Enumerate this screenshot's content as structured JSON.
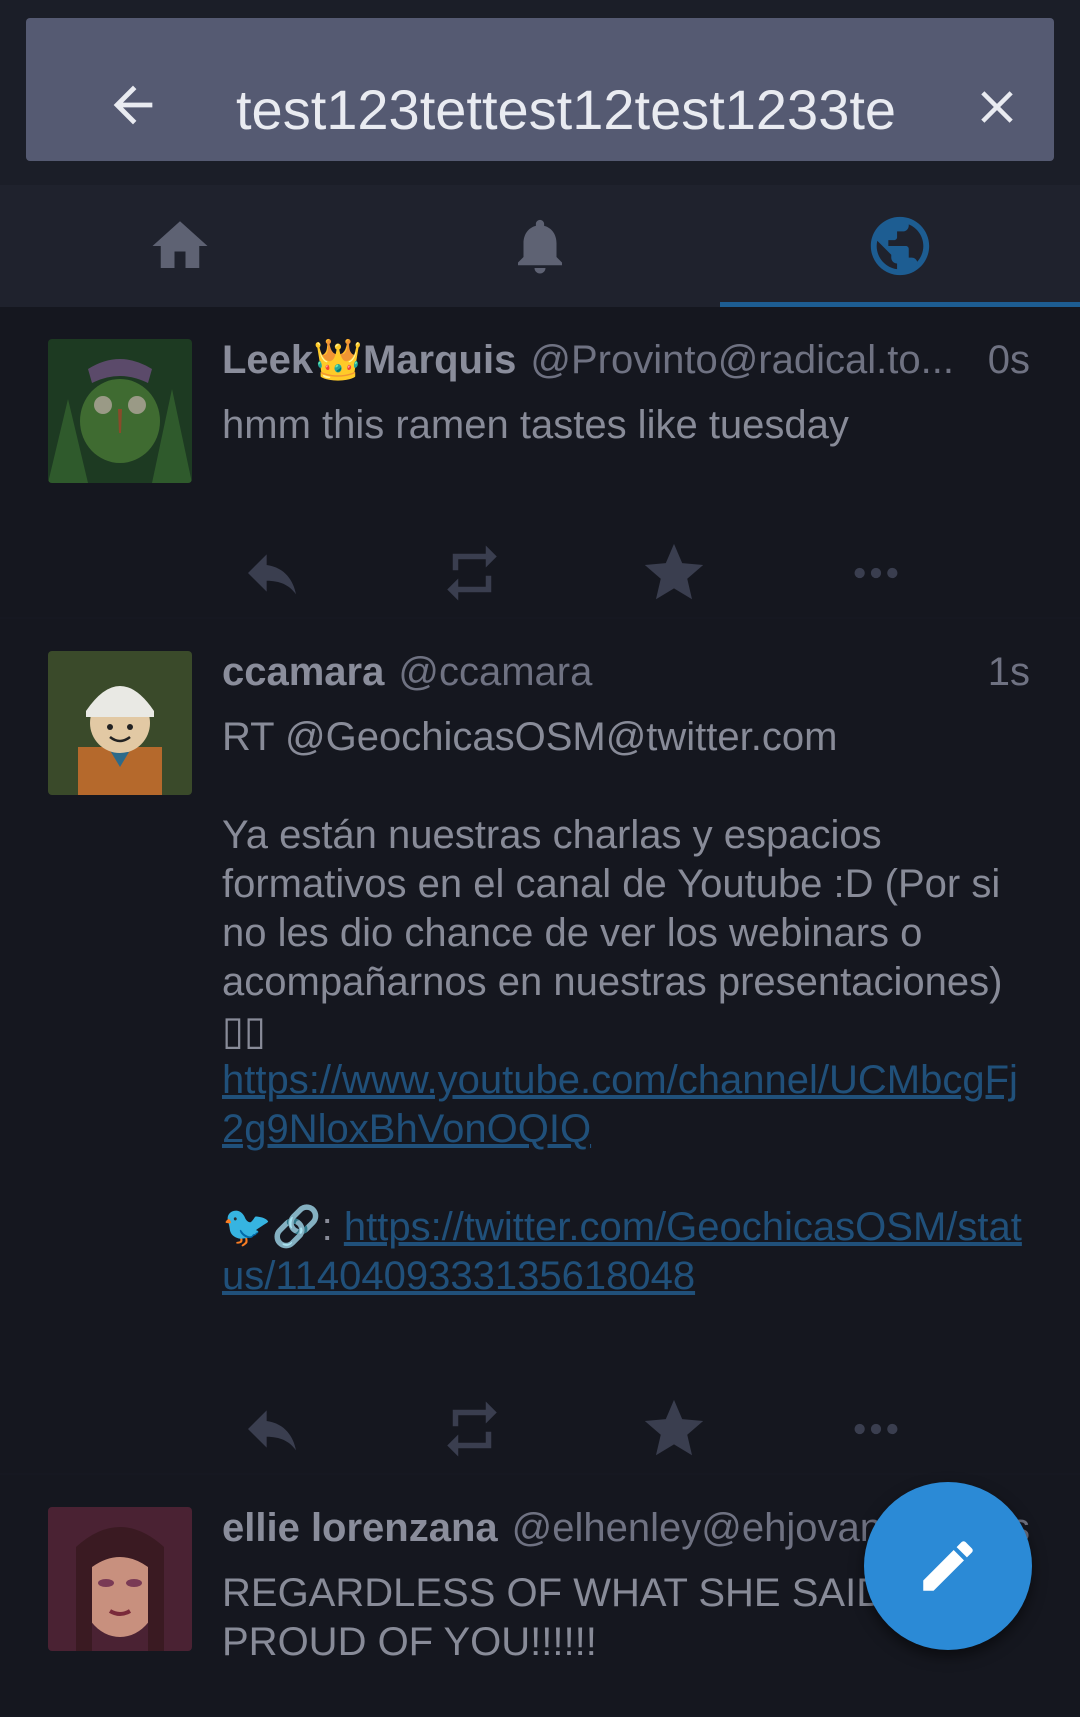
{
  "search": {
    "query": "test123tettest12test1233te",
    "back_icon": "arrow-left-icon",
    "clear_icon": "close-icon"
  },
  "tabs": [
    {
      "name": "home",
      "icon": "home-icon",
      "active": false
    },
    {
      "name": "notifications",
      "icon": "bell-icon",
      "active": false
    },
    {
      "name": "federated",
      "icon": "globe-icon",
      "active": true
    }
  ],
  "statuses": [
    {
      "display_name": "Leek👑Marquis",
      "handle": "@Provinto@radical.to...",
      "timestamp": "0s",
      "content": "hmm this ramen tastes like tuesday"
    },
    {
      "display_name": "ccamara",
      "handle": "@ccamara",
      "timestamp": "1s",
      "content_line1": "RT @GeochicasOSM@twitter.com",
      "content_line2": "Ya están nuestras charlas y espacios formativos en el canal de Youtube :D (Por si no les dio chance de ver los webinars o acompañarnos en nuestras presentaciones) ▯▯",
      "link1": "https://www.youtube.com/channel/UCMbcgFj2g9NloxBhVonOQIQ",
      "emoji_prefix": "🐦🔗: ",
      "link2": "https://twitter.com/GeochicasOSM/status/1140409333135618048"
    },
    {
      "display_name": "ellie lorenzana",
      "handle": "@elhenley@ehjovan",
      "timestamp": "s",
      "content": "REGARDLESS OF WHAT SHE SAID I'M PROUD OF YOU!!!!!!"
    }
  ],
  "fab": {
    "icon": "pencil-icon"
  },
  "colors": {
    "background": "#1b1e28",
    "search_bar": "#555a72",
    "accent": "#2b8ad6",
    "link": "#20507a"
  }
}
